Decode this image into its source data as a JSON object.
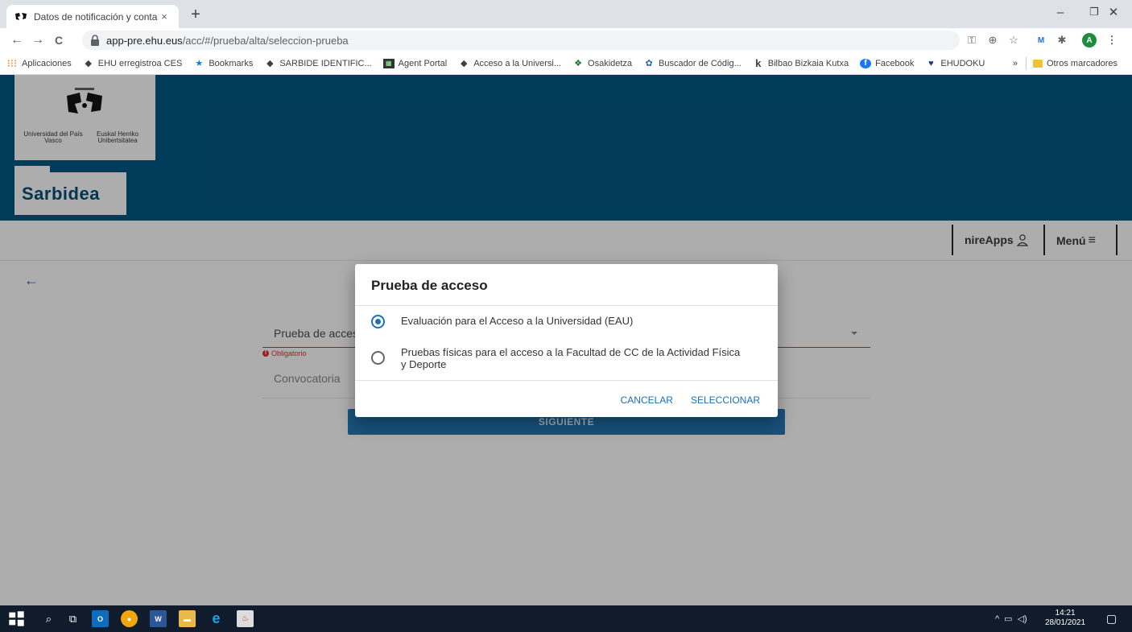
{
  "browser": {
    "tab_title": "Datos de notificación y contacto",
    "tab_close": "×",
    "new_tab": "+",
    "url_host": "app-pre.ehu.eus",
    "url_path": "/acc/#/prueba/alta/seleccion-prueba",
    "window": {
      "minimize": "–",
      "restore": "❐",
      "close": "✕"
    },
    "nav": {
      "back": "←",
      "forward": "→",
      "reload": "C"
    },
    "bookmarks": [
      {
        "label": "Aplicaciones",
        "icon": "apps-grid-icon"
      },
      {
        "label": "EHU erregistroa CES",
        "icon": "ehu-icon"
      },
      {
        "label": "Bookmarks",
        "icon": "star-icon"
      },
      {
        "label": "SARBIDE IDENTIFIC...",
        "icon": "ehu-icon"
      },
      {
        "label": "Agent Portal",
        "icon": "portal-icon"
      },
      {
        "label": "Acceso a la Universi...",
        "icon": "ehu-icon"
      },
      {
        "label": "Osakidetza",
        "icon": "osakidetza-icon"
      },
      {
        "label": "Buscador de Códig...",
        "icon": "search-code-icon"
      },
      {
        "label": "Bilbao Bizkaia Kutxa",
        "icon": "kutxa-icon"
      },
      {
        "label": "Facebook",
        "icon": "facebook-icon"
      },
      {
        "label": "EHUDOKU",
        "icon": "ehudoku-icon"
      }
    ],
    "bookmarks_overflow": "»",
    "other_bookmarks": "Otros marcadores",
    "profile_initial": "A"
  },
  "site": {
    "logo_left": "Universidad del País Vasco",
    "logo_right": "Euskal Herriko Unibertsitatea",
    "brand": "Sarbidea",
    "nav": {
      "nireapps": "nireApps",
      "menu": "Menú"
    }
  },
  "form": {
    "back": "←",
    "field1_label": "Prueba de acces",
    "error": "Obligatorio",
    "field2_label": "Convocatoria",
    "next": "SIGUIENTE"
  },
  "dialog": {
    "title": "Prueba de acceso",
    "options": [
      {
        "label": "Evaluación para el Acceso a la Universidad (EAU)",
        "selected": true
      },
      {
        "label": "Pruebas físicas para el acceso a la Facultad de CC de la Actividad Física y Deporte",
        "selected": false
      }
    ],
    "cancel": "CANCELAR",
    "select": "SELECCIONAR"
  },
  "taskbar": {
    "time": "14:21",
    "date": "28/01/2021"
  },
  "colors": {
    "hero_blue": "#014c72",
    "brand_text": "#044466",
    "accent": "#1a73b8",
    "error": "#c62828",
    "button": "#1f6a9f"
  }
}
